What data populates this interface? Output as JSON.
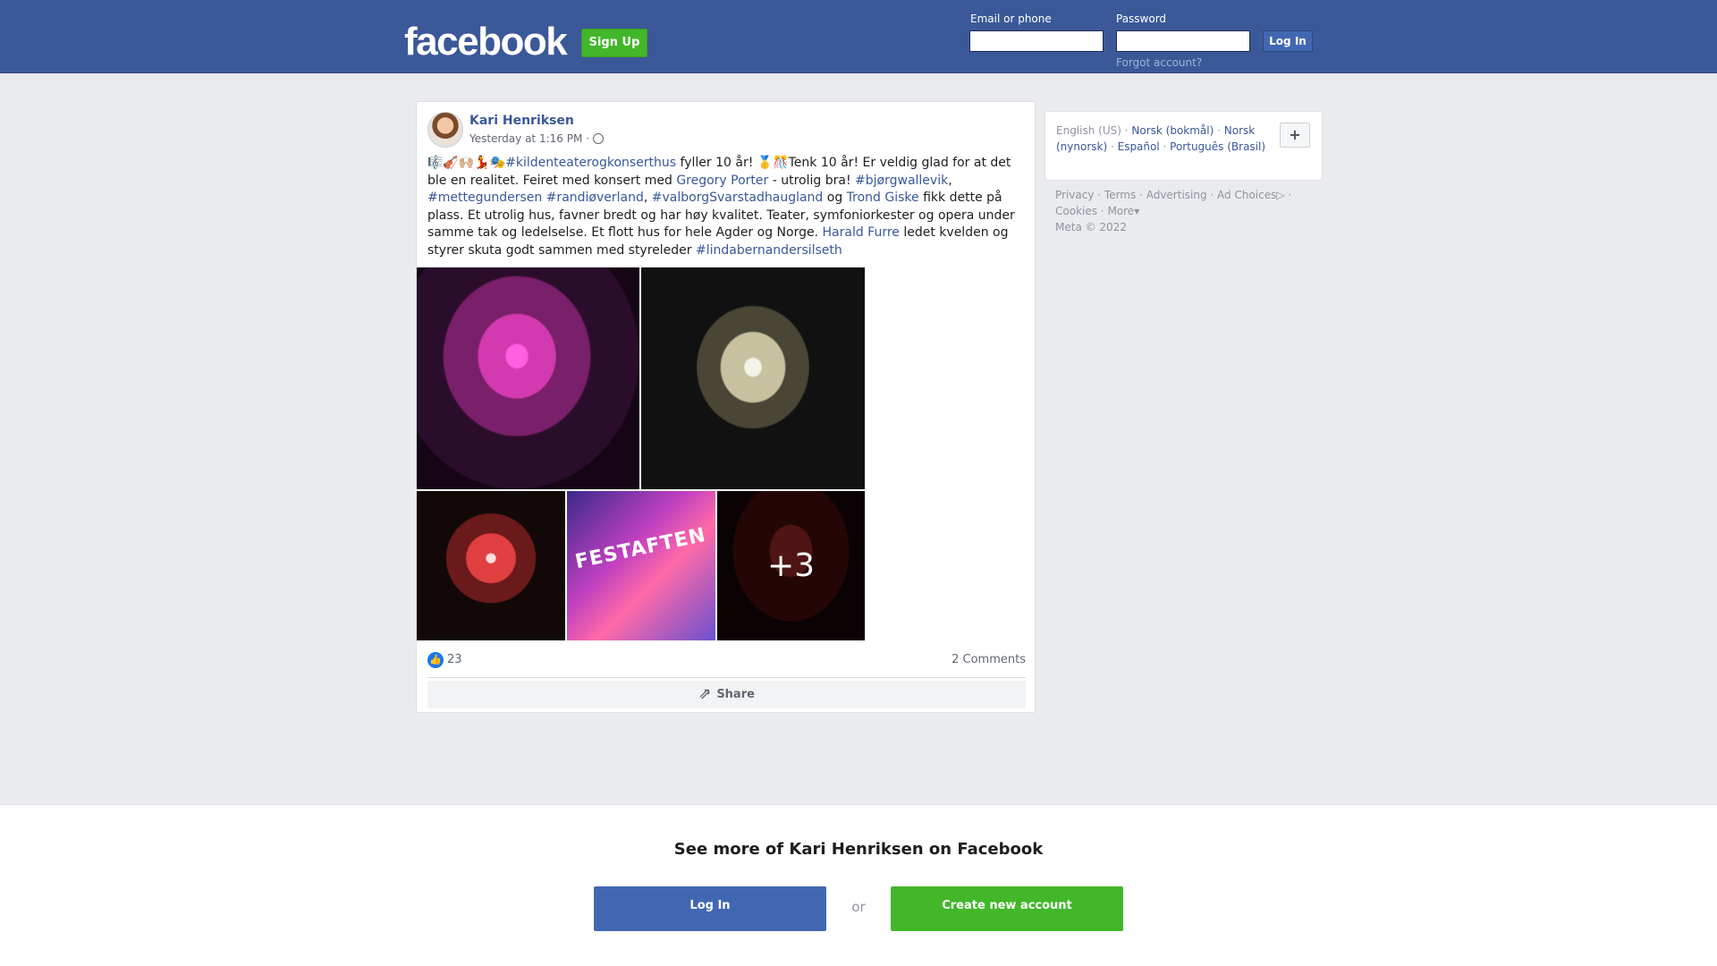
{
  "header": {
    "logo": "facebook",
    "signup_label": "Sign Up",
    "email_label": "Email or phone",
    "password_label": "Password",
    "login_label": "Log In",
    "forgot_label": "Forgot account?"
  },
  "post": {
    "author": "Kari Henriksen",
    "timestamp": "Yesterday at 1:16 PM",
    "separator": "·",
    "text": [
      {
        "t": "🎼🎻🙌🏼💃🎭",
        "link": false
      },
      {
        "t": "#kildenteaterogkonserthus",
        "link": true
      },
      {
        "t": " fyller 10 år! 🥇🎊Tenk 10 år! Er veldig glad for at det ble en realitet. Feiret med konsert med ",
        "link": false
      },
      {
        "t": "Gregory Porter",
        "link": true
      },
      {
        "t": " - utrolig bra! ",
        "link": false
      },
      {
        "t": "#bjørgwallevik",
        "link": true
      },
      {
        "t": ", ",
        "link": false
      },
      {
        "t": "#mettegundersen",
        "link": true
      },
      {
        "t": " ",
        "link": false
      },
      {
        "t": "#randiøverland",
        "link": true
      },
      {
        "t": ", ",
        "link": false
      },
      {
        "t": "#valborgSvarstadhaugland",
        "link": true
      },
      {
        "t": " og ",
        "link": false
      },
      {
        "t": "Trond Giske",
        "link": true
      },
      {
        "t": " fikk dette på plass. Et utrolig hus, favner bredt og har høy kvalitet. Teater, symfoniorkester og opera under samme tak og ledelselse. Et flott hus for hele Agder og Norge. ",
        "link": false
      },
      {
        "t": "Harald Furre",
        "link": true
      },
      {
        "t": " ledet kvelden og styrer skuta godt sammen med styreleder ",
        "link": false
      },
      {
        "t": "#lindabernandersilseth",
        "link": true
      }
    ],
    "photo_caption": "FESTAFTEN",
    "more_photos": "+3",
    "like_count": "23",
    "comments_label": "2 Comments",
    "share_label": "Share"
  },
  "sidebar": {
    "current_lang": "English (US)",
    "languages": [
      "Norsk (bokmål)",
      "Norsk (nynorsk)",
      "Español",
      "Português (Brasil)"
    ],
    "plus_label": "+",
    "footer": [
      "Privacy",
      "Terms",
      "Advertising",
      "Ad Choices",
      "Cookies",
      "More"
    ],
    "copyright": "Meta © 2022"
  },
  "bottom": {
    "title": "See more of Kari Henriksen on Facebook",
    "login_label": "Log In",
    "or_label": "or",
    "create_label": "Create new account"
  },
  "colors": {
    "brand_blue": "#3b5998",
    "button_blue": "#4267b2",
    "link_blue": "#385898",
    "green": "#42b72a"
  },
  "icons": {
    "globe": "globe-icon",
    "like": "like-icon",
    "share": "share-icon",
    "ad_choices": "ad-choices-icon"
  }
}
